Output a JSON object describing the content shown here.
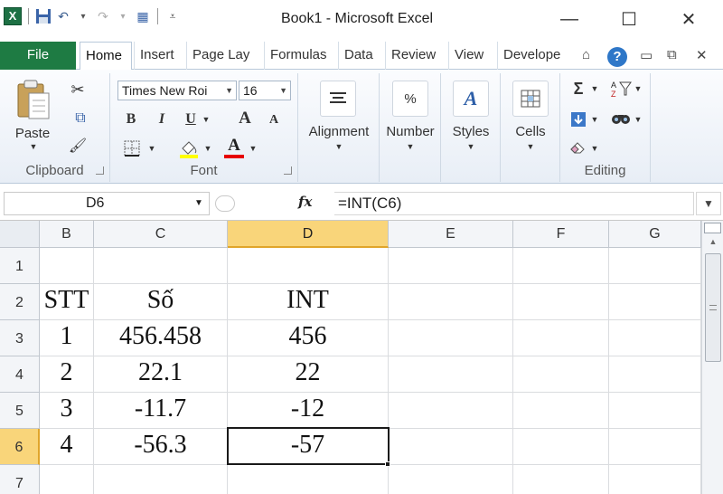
{
  "window": {
    "title": "Book1  -  Microsoft Excel",
    "logo_letter": "X",
    "minimize_glyph": "—",
    "maximize_glyph": "☐",
    "close_glyph": "✕"
  },
  "qat": {
    "save_icon": "save-icon",
    "undo_glyph": "↶",
    "redo_glyph": "↷",
    "calc_glyph": "▦",
    "dropdown_glyph": "▾",
    "customize_glyph": "⩡"
  },
  "tabs": {
    "file": "File",
    "items": [
      "Home",
      "Insert",
      "Page Lay",
      "Formulas",
      "Data",
      "Review",
      "View",
      "Develope"
    ],
    "active": "Home",
    "help_glyph": "?"
  },
  "ribbon": {
    "clipboard": {
      "label": "Clipboard",
      "paste": "Paste",
      "cut_glyph": "✂",
      "copy_glyph": "⧉",
      "format_painter_glyph": "🖌"
    },
    "font": {
      "label": "Font",
      "font_name": "Times New Roi",
      "font_size": "16",
      "bold": "B",
      "italic": "I",
      "underline": "U",
      "grow": "A",
      "shrink": "A",
      "font_color_letter": "A",
      "highlight_color": "#ffff00",
      "font_color": "#e60000"
    },
    "alignment": {
      "label": "Alignment"
    },
    "number": {
      "label": "Number",
      "icon_text": "%"
    },
    "styles": {
      "label": "Styles",
      "icon_text": "A"
    },
    "cells": {
      "label": "Cells"
    },
    "editing": {
      "label": "Editing",
      "sum_glyph": "Σ",
      "find_glyph": "🔭",
      "clear_glyph": "⌫"
    }
  },
  "formula_bar": {
    "name_box": "D6",
    "fx": "fx",
    "formula": "=INT(C6)"
  },
  "sheet": {
    "columns": [
      "B",
      "C",
      "D",
      "E",
      "F",
      "G"
    ],
    "selected_column": "D",
    "rows": [
      "1",
      "2",
      "3",
      "4",
      "5",
      "6",
      "7"
    ],
    "selected_row": "6",
    "active_cell": "D6",
    "cells": {
      "r1": [
        "",
        "",
        "",
        "",
        "",
        ""
      ],
      "r2": [
        "STT",
        "Số",
        "INT",
        "",
        "",
        ""
      ],
      "r3": [
        "1",
        "456.458",
        "456",
        "",
        "",
        ""
      ],
      "r4": [
        "2",
        "22.1",
        "22",
        "",
        "",
        ""
      ],
      "r5": [
        "3",
        "-11.7",
        "-12",
        "",
        "",
        ""
      ],
      "r6": [
        "4",
        "-56.3",
        "-57",
        "",
        "",
        ""
      ],
      "r7": [
        "",
        "",
        "",
        "",
        "",
        ""
      ]
    }
  },
  "colors": {
    "file_tab": "#1e7b43",
    "selection_header": "#f9d57a",
    "help": "#2e77c8"
  }
}
